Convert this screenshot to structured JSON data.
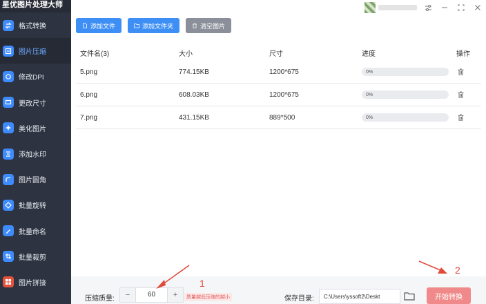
{
  "app": {
    "title": "星优图片处理大师"
  },
  "sidebar": {
    "items": [
      {
        "label": "格式转换",
        "icon": "convert-icon"
      },
      {
        "label": "图片压缩",
        "icon": "compress-icon",
        "active": true
      },
      {
        "label": "修改DPI",
        "icon": "dpi-icon"
      },
      {
        "label": "更改尺寸",
        "icon": "resize-icon"
      },
      {
        "label": "美化图片",
        "icon": "beautify-icon"
      },
      {
        "label": "添加水印",
        "icon": "watermark-icon"
      },
      {
        "label": "图片圆角",
        "icon": "round-corner-icon"
      },
      {
        "label": "批量旋转",
        "icon": "rotate-icon"
      },
      {
        "label": "批量命名",
        "icon": "rename-icon"
      },
      {
        "label": "批量裁剪",
        "icon": "crop-icon"
      },
      {
        "label": "图片拼接",
        "icon": "stitch-icon"
      }
    ]
  },
  "toolbar": {
    "add_file": "添加文件",
    "add_folder": "添加文件夹",
    "clear": "清空图片"
  },
  "table": {
    "headers": {
      "name": "文件名(3)",
      "size": "大小",
      "dimension": "尺寸",
      "progress": "进度",
      "action": "操作"
    },
    "rows": [
      {
        "name": "5.png",
        "size": "774.15KB",
        "dimension": "1200*675",
        "progress": "0%"
      },
      {
        "name": "6.png",
        "size": "608.03KB",
        "dimension": "1200*675",
        "progress": "0%"
      },
      {
        "name": "7.png",
        "size": "431.15KB",
        "dimension": "889*500",
        "progress": "0%"
      }
    ]
  },
  "bottom": {
    "quality_label": "压缩质量:",
    "quality_value": "60",
    "quality_tip": "质量越低压缩的越小",
    "output_label": "保存目录:",
    "output_path": "C:\\Users\\yssoft2\\Deskt",
    "start_label": "开始转换"
  },
  "annotations": {
    "label1": "1",
    "label2": "2"
  },
  "colors": {
    "accent": "#3d8ff5",
    "start": "#f08a8a",
    "arrow": "#e04a3a",
    "sidebar": "#2d3340"
  }
}
